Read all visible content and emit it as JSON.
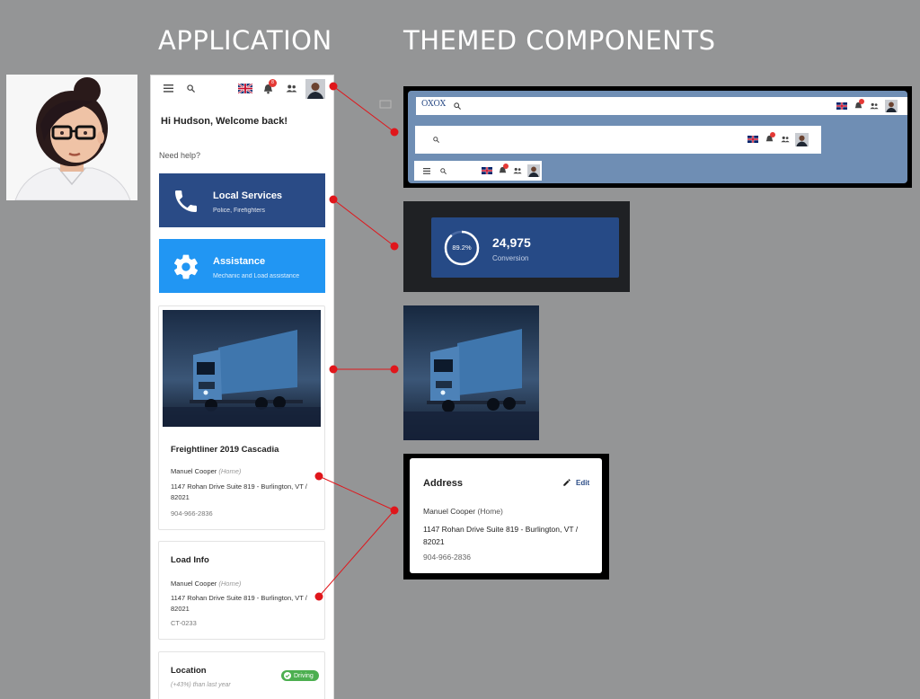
{
  "headings": {
    "application": "APPLICATION",
    "themed": "THEMED COMPONENTS"
  },
  "app": {
    "topbar": {
      "menu_icon": "menu-icon",
      "search_icon": "search-icon",
      "notification_count": "8"
    },
    "greeting": "Hi Hudson, Welcome back!",
    "need_help": "Need help?",
    "services": [
      {
        "title": "Local Services",
        "subtitle": "Police, Firefighters",
        "icon": "phone-icon",
        "color": "#2a4b86"
      },
      {
        "title": "Assistance",
        "subtitle": "Mechanic and Load assistance",
        "icon": "gear-icon",
        "color": "#2196f3"
      }
    ],
    "vehicle": {
      "name": "Freightliner 2019 Cascadia",
      "contact": "Manuel Cooper",
      "contact_tag": "(Home)",
      "address_line1": "1147 Rohan Drive Suite 819 - Burlington, VT /",
      "address_line2": "82021",
      "phone": "904-966-2836"
    },
    "load_info": {
      "title": "Load  Info",
      "contact": "Manuel Cooper",
      "contact_tag": "(Home)",
      "address_line1": "1147 Rohan Drive Suite 819 - Burlington, VT /",
      "address_line2": "82021",
      "code": "CT-0233"
    },
    "location": {
      "title": "Location",
      "subtitle": "(+43%) than last year",
      "badge": "Driving",
      "badge_color": "#4caf50"
    }
  },
  "themed": {
    "topbar_brand": "OXOX",
    "stat": {
      "percent": "89.2%",
      "percent_value": 89.2,
      "value": "24,975",
      "label": "Conversion"
    },
    "address": {
      "title": "Address",
      "edit": "Edit",
      "contact": "Manuel Cooper",
      "contact_tag": "(Home)",
      "address_line1": "1147 Rohan Drive Suite 819 - Burlington, VT /",
      "address_line2": "82021",
      "phone": "904-966-2836"
    }
  },
  "colors": {
    "accent_red": "#e0161b",
    "dark_blue": "#2a4b86",
    "light_blue": "#2196f3",
    "panel_blue": "#6f8eb4"
  }
}
